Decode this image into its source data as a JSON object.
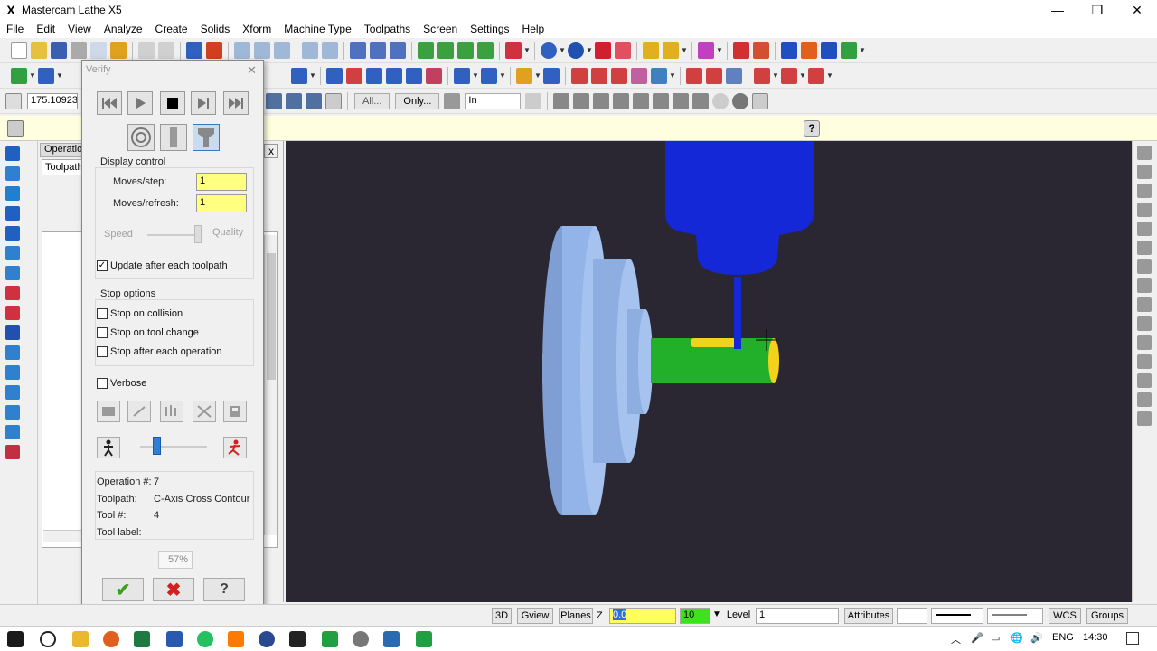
{
  "window": {
    "title": "Mastercam Lathe X5",
    "app_icon": "mastercam-x-icon",
    "minimize": "—",
    "maximize": "❐",
    "close": "✕"
  },
  "menu": [
    "File",
    "Edit",
    "View",
    "Analyze",
    "Create",
    "Solids",
    "Xform",
    "Machine Type",
    "Toolpaths",
    "Screen",
    "Settings",
    "Help"
  ],
  "toolbar3": {
    "coord_value": "175.10923",
    "all_label": "All...",
    "only_label": "Only...",
    "in_label": "In"
  },
  "ops_panel": {
    "tab_label": "Operation",
    "subtab_label": "Toolpaths",
    "close": "x"
  },
  "verify": {
    "title": "Verify",
    "close": "✕",
    "display_control_label": "Display control",
    "moves_step_label": "Moves/step:",
    "moves_step_value": "1",
    "moves_refresh_label": "Moves/refresh:",
    "moves_refresh_value": "1",
    "speed_label": "Speed",
    "quality_label": "Quality",
    "update_after_toolpath_label": "Update after each toolpath",
    "update_after_toolpath_checked": true,
    "stop_options_label": "Stop options",
    "stop_on_collision_label": "Stop on collision",
    "stop_on_tool_change_label": "Stop on tool change",
    "stop_after_operation_label": "Stop after each operation",
    "verbose_label": "Verbose",
    "operation_label": "Operation #:",
    "operation_value": "7",
    "toolpath_label": "Toolpath:",
    "toolpath_value": "C-Axis Cross Contour",
    "tool_label": "Tool #:",
    "tool_value": "4",
    "tool_label_label": "Tool label:",
    "progress_percent": "57%",
    "ok_glyph": "✔",
    "cancel_glyph": "✖",
    "help_glyph": "?"
  },
  "status_bar": {
    "view_3d": "3D",
    "gview": "Gview",
    "planes": "Planes",
    "z_label": "Z",
    "z_value": "0.0",
    "color_value": "10",
    "level_label": "Level",
    "level_value": "1",
    "attributes": "Attributes",
    "wcs": "WCS",
    "groups": "Groups"
  },
  "taskbar": {
    "lang": "ENG",
    "time": "14:30"
  },
  "colors": {
    "viewport_bg": "#2a2632",
    "part_body": "#93b4e8",
    "shaft": "#22b02a",
    "tool_holder": "#1428d8",
    "highlight": "#f2d21a"
  }
}
